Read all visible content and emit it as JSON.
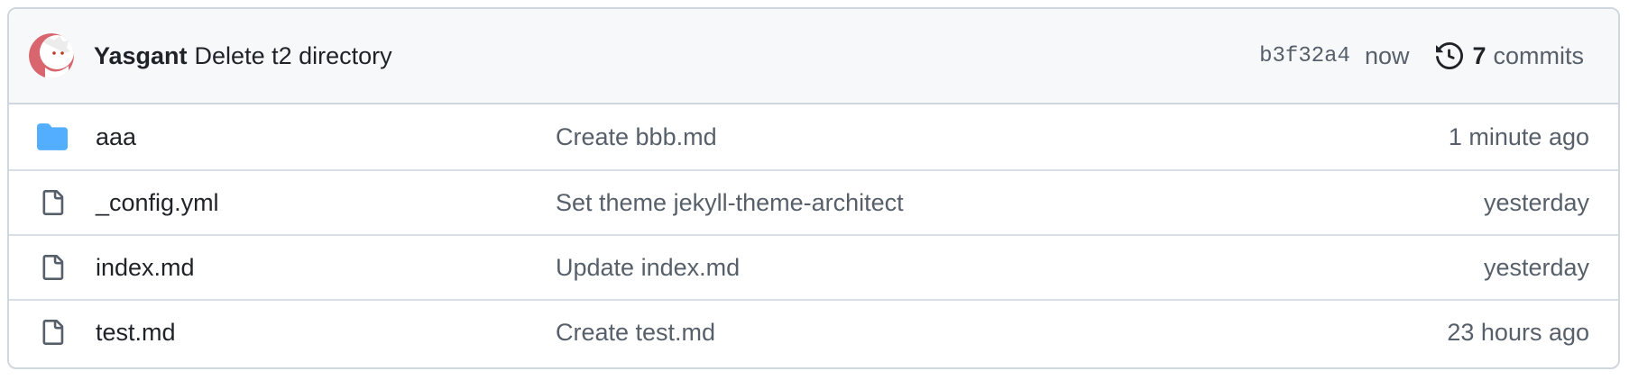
{
  "latest_commit": {
    "author": "Yasgant",
    "message": "Delete t2 directory",
    "sha": "b3f32a4",
    "time": "now",
    "commits_count": "7",
    "commits_label": "commits"
  },
  "files": [
    {
      "name": "aaa",
      "type": "folder",
      "icon": "folder-icon",
      "message": "Create bbb.md",
      "age": "1 minute ago"
    },
    {
      "name": "_config.yml",
      "type": "file",
      "icon": "file-icon",
      "message": "Set theme jekyll-theme-architect",
      "age": "yesterday"
    },
    {
      "name": "index.md",
      "type": "file",
      "icon": "file-icon",
      "message": "Update index.md",
      "age": "yesterday"
    },
    {
      "name": "test.md",
      "type": "file",
      "icon": "file-icon",
      "message": "Create test.md",
      "age": "23 hours ago"
    }
  ],
  "colors": {
    "folder": "#54aeff",
    "file_icon": "#57606a",
    "border": "#d0d7de",
    "header_bg": "#f6f8fa"
  }
}
